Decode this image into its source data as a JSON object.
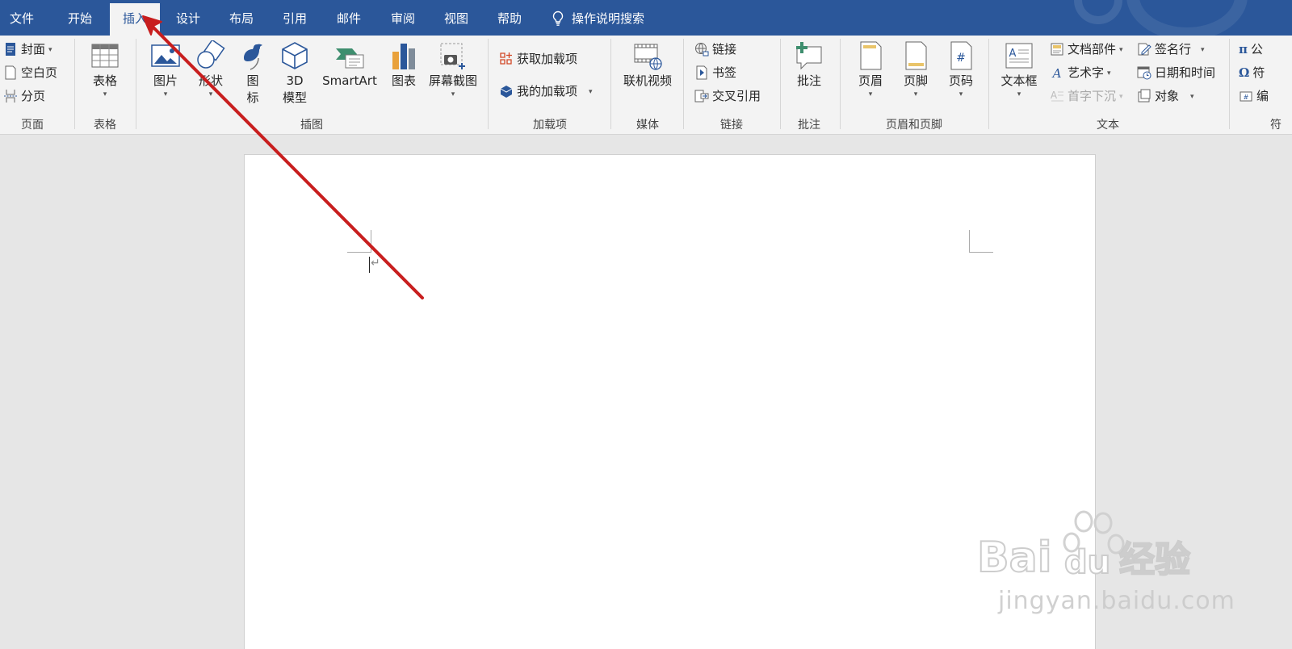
{
  "tabs": [
    {
      "label": "文件",
      "active": false
    },
    {
      "label": "开始",
      "active": false
    },
    {
      "label": "插入",
      "active": true
    },
    {
      "label": "设计",
      "active": false
    },
    {
      "label": "布局",
      "active": false
    },
    {
      "label": "引用",
      "active": false
    },
    {
      "label": "邮件",
      "active": false
    },
    {
      "label": "审阅",
      "active": false
    },
    {
      "label": "视图",
      "active": false
    },
    {
      "label": "帮助",
      "active": false
    }
  ],
  "tell_me": "操作说明搜索",
  "ribbon": {
    "pages": {
      "label": "页面",
      "cover": "封面",
      "blank": "空白页",
      "break": "分页"
    },
    "tables": {
      "label": "表格",
      "table": "表格"
    },
    "illustrations": {
      "label": "插图",
      "picture": "图片",
      "shapes": "形状",
      "icons_1": "图",
      "icons_2": "标",
      "model_1": "3D",
      "model_2": "模型",
      "smartart": "SmartArt",
      "chart": "图表",
      "screenshot": "屏幕截图"
    },
    "addins": {
      "label": "加载项",
      "get": "获取加载项",
      "mine": "我的加载项"
    },
    "media": {
      "label": "媒体",
      "video": "联机视频"
    },
    "links": {
      "label": "链接",
      "link": "链接",
      "bookmark": "书签",
      "crossref": "交叉引用"
    },
    "comments": {
      "label": "批注",
      "comment": "批注"
    },
    "header_footer": {
      "label": "页眉和页脚",
      "header": "页眉",
      "footer": "页脚",
      "page_number": "页码"
    },
    "text": {
      "label": "文本",
      "textbox": "文本框",
      "quick_parts": "文档部件",
      "wordart": "艺术字",
      "dropcap": "首字下沉",
      "signature": "签名行",
      "datetime": "日期和时间",
      "object": "对象"
    },
    "symbols": {
      "label": "符",
      "equation": "公",
      "symbol": "符",
      "number": "编"
    }
  },
  "document": {
    "paragraph_mark": "↵"
  },
  "watermark": {
    "site": "jingyan.baidu.com",
    "brand_1": "Bai",
    "brand_2": "du",
    "brand_3": "经验"
  },
  "colors": {
    "accent": "#2b579a",
    "arrow": "#c81e1e"
  }
}
